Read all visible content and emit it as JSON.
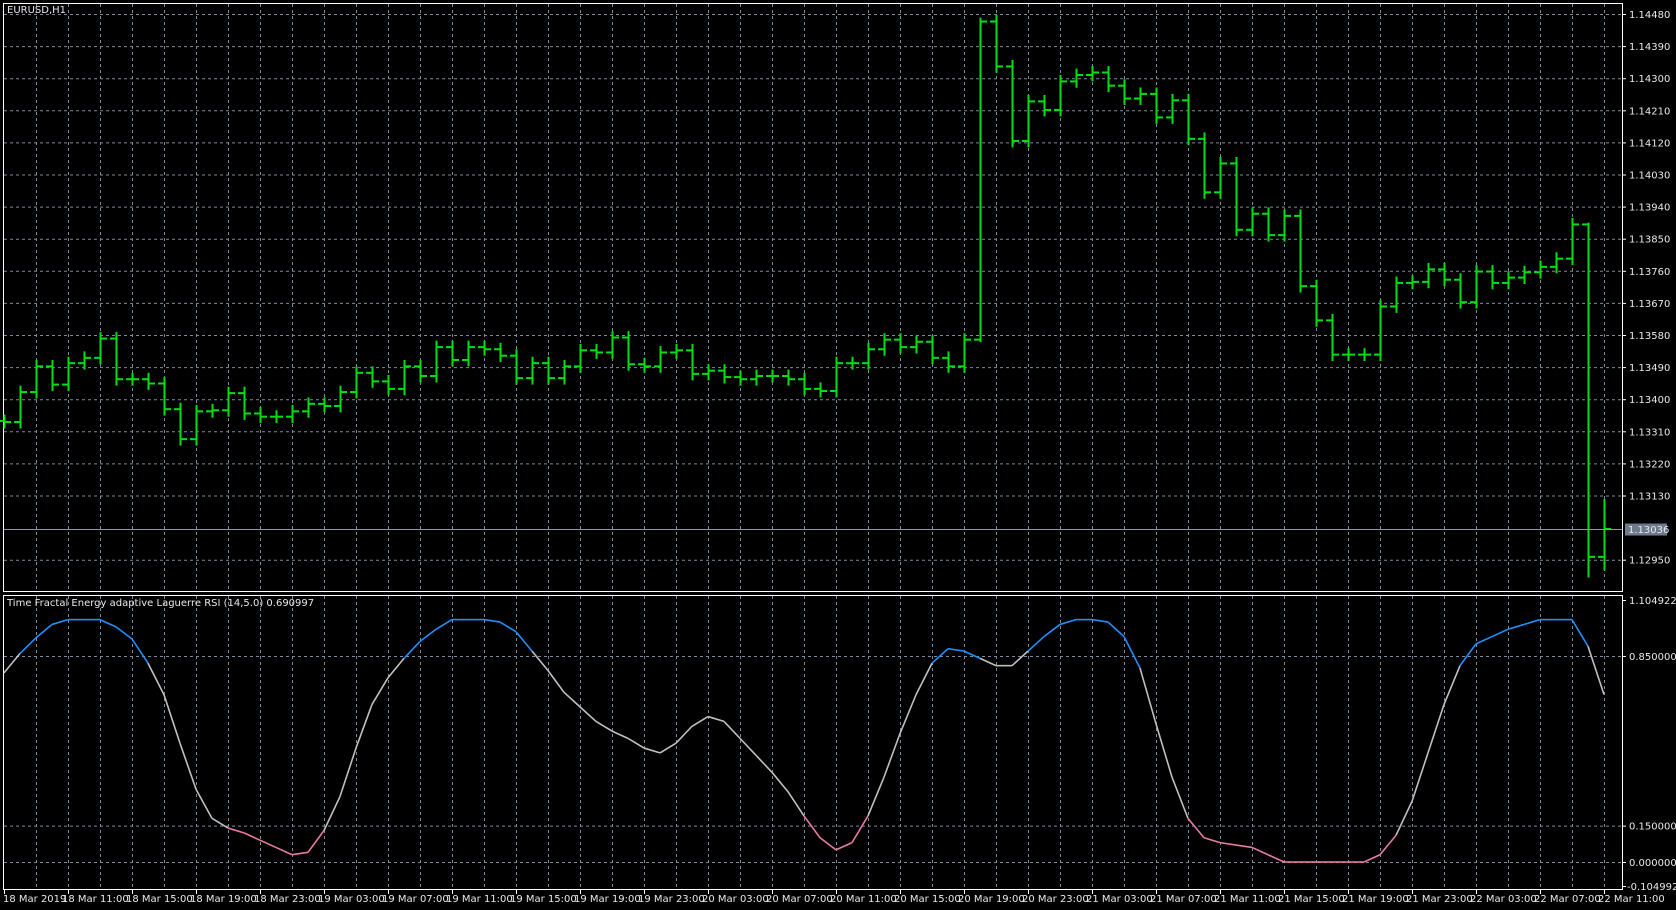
{
  "window": {
    "symbol_label": "EURUSD,H1",
    "indicator_label": "Time Fractal Energy adaptive Laguerre RSI (14,5.0) 0.690997"
  },
  "colors": {
    "background": "#000000",
    "grid": "#7b8a9e",
    "bars": "#00e010",
    "rsi_high": "#1e90ff",
    "rsi_mid": "#c0c0c0",
    "rsi_low": "#e87aa6",
    "current_price_box": "#6d7b8d"
  },
  "price_axis": {
    "labels": [
      "1.14480",
      "1.14390",
      "1.14300",
      "1.14210",
      "1.14120",
      "1.14030",
      "1.13940",
      "1.13850",
      "1.13760",
      "1.13670",
      "1.13580",
      "1.13490",
      "1.13400",
      "1.13310",
      "1.13220",
      "1.13130",
      "1.12950"
    ],
    "current_price": "1.13036"
  },
  "indicator_axis": {
    "labels": [
      "1.104922",
      "0.850000",
      "0.150000",
      "0.000000",
      "-0.104992"
    ]
  },
  "time_axis": {
    "labels": [
      "18 Mar 2019",
      "18 Mar 11:00",
      "18 Mar 15:00",
      "18 Mar 19:00",
      "18 Mar 23:00",
      "19 Mar 03:00",
      "19 Mar 07:00",
      "19 Mar 11:00",
      "19 Mar 15:00",
      "19 Mar 19:00",
      "19 Mar 23:00",
      "20 Mar 03:00",
      "20 Mar 07:00",
      "20 Mar 11:00",
      "20 Mar 15:00",
      "20 Mar 19:00",
      "20 Mar 23:00",
      "21 Mar 03:00",
      "21 Mar 07:00",
      "21 Mar 11:00",
      "21 Mar 15:00",
      "21 Mar 19:00",
      "21 Mar 23:00",
      "22 Mar 03:00",
      "22 Mar 07:00",
      "22 Mar 11:00"
    ]
  },
  "chart_data": [
    {
      "type": "ohlc",
      "title": "EURUSD,H1",
      "ylim": [
        1.1289,
        1.1451
      ],
      "x_start": "18 Mar 2019 07:00",
      "x_step": "1 hour",
      "close": [
        1.13336,
        1.1342,
        1.13492,
        1.13441,
        1.13501,
        1.13516,
        1.1357,
        1.13456,
        1.13456,
        1.13444,
        1.13372,
        1.13288,
        1.13366,
        1.13369,
        1.13417,
        1.1336,
        1.13351,
        1.13351,
        1.13366,
        1.13387,
        1.13381,
        1.1342,
        1.13474,
        1.1345,
        1.13429,
        1.13492,
        1.13465,
        1.13546,
        1.1351,
        1.13546,
        1.1354,
        1.13522,
        1.13459,
        1.13501,
        1.13459,
        1.13492,
        1.13537,
        1.13531,
        1.13573,
        1.13498,
        1.13492,
        1.13531,
        1.13537,
        1.13471,
        1.1348,
        1.13462,
        1.13456,
        1.13465,
        1.13465,
        1.13456,
        1.13429,
        1.13423,
        1.13501,
        1.13501,
        1.1354,
        1.13567,
        1.13546,
        1.13561,
        1.13516,
        1.13492,
        1.13567,
        1.14459,
        1.14333,
        1.14124,
        1.14235,
        1.14211,
        1.14291,
        1.14309,
        1.14316,
        1.14279,
        1.14243,
        1.14256,
        1.1419,
        1.14238,
        1.1413,
        1.1398,
        1.14061,
        1.13875,
        1.1392,
        1.1386,
        1.13914,
        1.13717,
        1.13621,
        1.13525,
        1.13525,
        1.13525,
        1.1366,
        1.13726,
        1.13729,
        1.13764,
        1.13735,
        1.13672,
        1.13758,
        1.13726,
        1.13741,
        1.13756,
        1.13771,
        1.13794,
        1.1389,
        1.12958,
        1.13036
      ],
      "extremes": {
        "61": [
          1.1447,
          1.1356
        ],
        "99": [
          1.13895,
          1.129
        ],
        "100": [
          1.1312,
          1.1292
        ]
      }
    },
    {
      "type": "line",
      "title": "Time Fractal Energy adaptive Laguerre RSI (14,5.0)",
      "ylim": [
        -0.104992,
        1.104922
      ],
      "levels": [
        0.85,
        0.15,
        0.0
      ],
      "values": [
        0.78,
        0.86,
        0.925,
        0.98,
        1.0,
        1.0,
        1.0,
        0.97,
        0.92,
        0.82,
        0.69,
        0.49,
        0.3,
        0.18,
        0.14,
        0.12,
        0.09,
        0.06,
        0.03,
        0.04,
        0.13,
        0.27,
        0.47,
        0.65,
        0.76,
        0.84,
        0.91,
        0.96,
        1.0,
        1.0,
        1.0,
        0.99,
        0.95,
        0.87,
        0.79,
        0.7,
        0.64,
        0.58,
        0.54,
        0.51,
        0.47,
        0.45,
        0.49,
        0.56,
        0.6,
        0.58,
        0.51,
        0.44,
        0.37,
        0.29,
        0.19,
        0.1,
        0.05,
        0.08,
        0.19,
        0.35,
        0.53,
        0.69,
        0.82,
        0.88,
        0.87,
        0.84,
        0.81,
        0.81,
        0.87,
        0.93,
        0.98,
        1.0,
        1.0,
        0.99,
        0.93,
        0.8,
        0.57,
        0.35,
        0.18,
        0.1,
        0.08,
        0.07,
        0.06,
        0.03,
        0.0,
        0.0,
        0.0,
        0.0,
        0.0,
        0.0,
        0.03,
        0.11,
        0.25,
        0.45,
        0.65,
        0.81,
        0.9,
        0.93,
        0.96,
        0.98,
        1.0,
        1.0,
        1.0,
        0.89,
        0.690997
      ]
    }
  ]
}
